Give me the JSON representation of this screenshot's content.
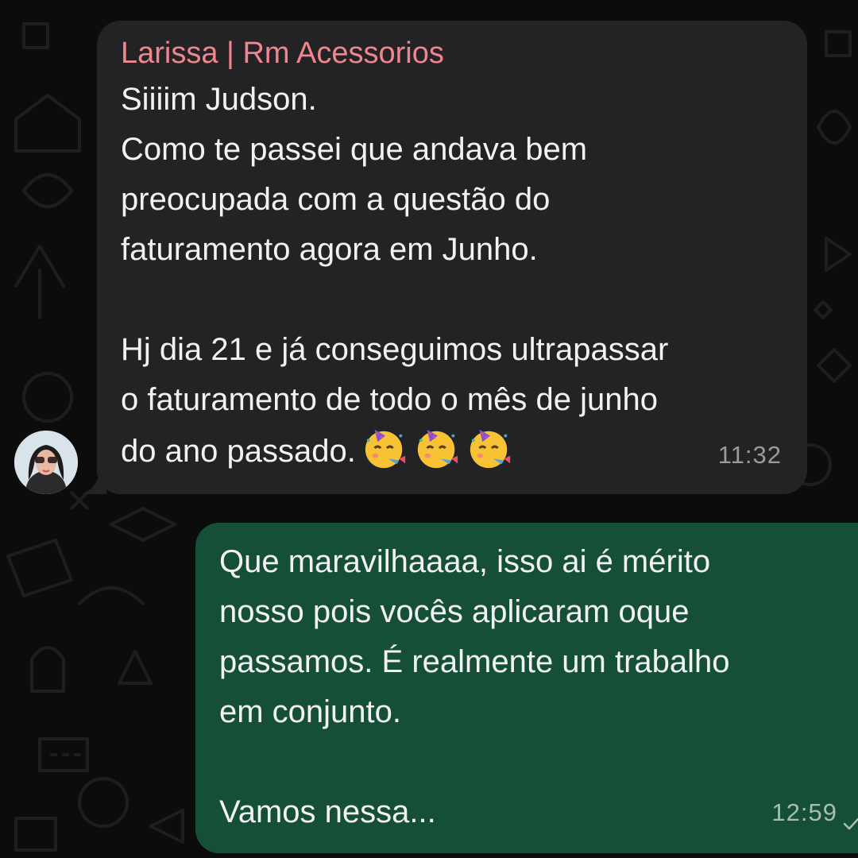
{
  "incoming": {
    "sender": "Larissa | Rm Acessorios",
    "text": "Siiiim Judson.\nComo te passei que andava bem\npreocupada com a questão do\nfaturamento agora em Junho.\n\nHj dia 21 e já conseguimos ultrapassar\no faturamento de todo o mês de junho\ndo ano passado.",
    "emojis": [
      "partying-face-emoji",
      "partying-face-emoji",
      "partying-face-emoji"
    ],
    "time": "11:32",
    "avatar_icon": "contact-avatar"
  },
  "outgoing": {
    "text": "Que maravilhaaaa, isso ai é mérito\nnosso pois vocês aplicaram oque\npassamos. É realmente um trabalho\nem conjunto.\n\nVamos nessa...",
    "time": "12:59",
    "status_icon": "check-icon"
  },
  "colors": {
    "background": "#0c0c0c",
    "incoming_bubble": "#232325",
    "outgoing_bubble": "#154f38",
    "sender_name": "#f0848f",
    "text": "#f2f2f2",
    "timestamp": "#9a9a9a"
  }
}
